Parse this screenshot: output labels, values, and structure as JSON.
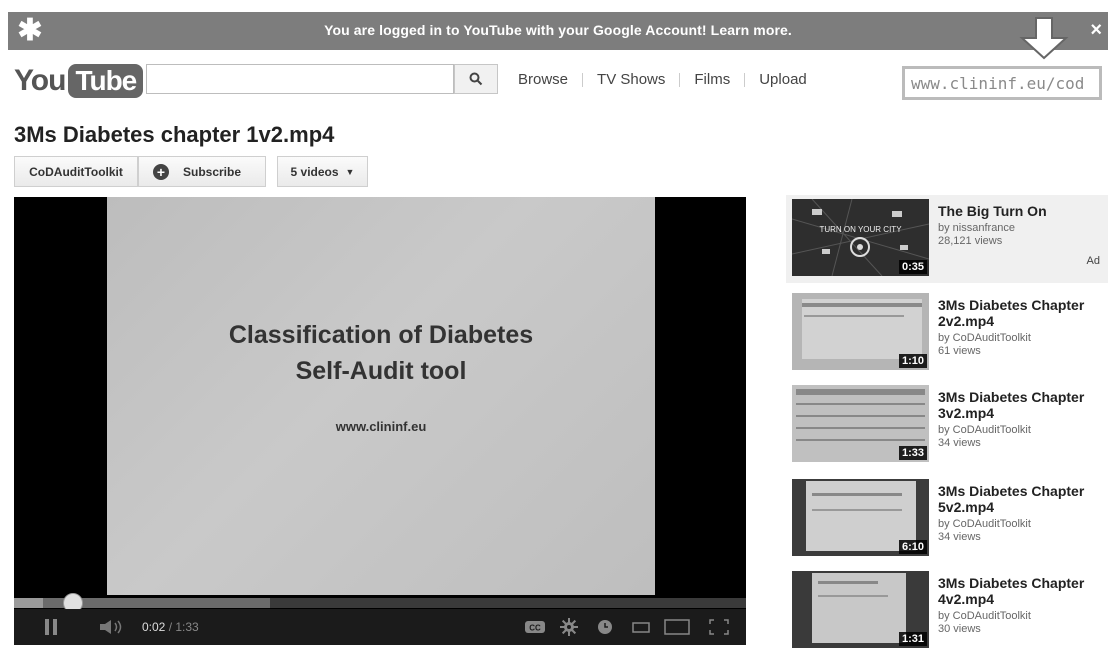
{
  "notification": {
    "message": "You are logged in to YouTube with your Google Account! Learn more.",
    "close": "×"
  },
  "header": {
    "logo_you": "You",
    "logo_tube": "Tube",
    "search_value": "",
    "nav": [
      "Browse",
      "TV Shows",
      "Films",
      "Upload"
    ],
    "overlay_url": "www.clininf.eu/cod"
  },
  "video": {
    "title": "3Ms Diabetes chapter 1v2.mp4",
    "channel_button": "CoDAuditToolkit",
    "subscribe_button": "Subscribe",
    "videos_button": "5 videos",
    "slide_line1": "Classification of Diabetes",
    "slide_line2": "Self-Audit tool",
    "slide_url": "www.clininf.eu",
    "current_time": "0:02",
    "duration": "/ 1:33",
    "played_fraction": 0.04,
    "buffered_fraction": 0.35
  },
  "sidebar": {
    "items": [
      {
        "title": "The Big Turn On",
        "by": "by nissanfrance",
        "views": "28,121 views",
        "duration": "0:35",
        "ad_label": "Ad",
        "thumb_text": "TURN ON YOUR CITY"
      },
      {
        "title": "3Ms Diabetes Chapter 2v2.mp4",
        "by": "by CoDAuditToolkit",
        "views": "61 views",
        "duration": "1:10"
      },
      {
        "title": "3Ms Diabetes Chapter 3v2.mp4",
        "by": "by CoDAuditToolkit",
        "views": "34 views",
        "duration": "1:33"
      },
      {
        "title": "3Ms Diabetes Chapter 5v2.mp4",
        "by": "by CoDAuditToolkit",
        "views": "34 views",
        "duration": "6:10"
      },
      {
        "title": "3Ms Diabetes Chapter 4v2.mp4",
        "by": "by CoDAuditToolkit",
        "views": "30 views",
        "duration": "1:31"
      }
    ]
  }
}
